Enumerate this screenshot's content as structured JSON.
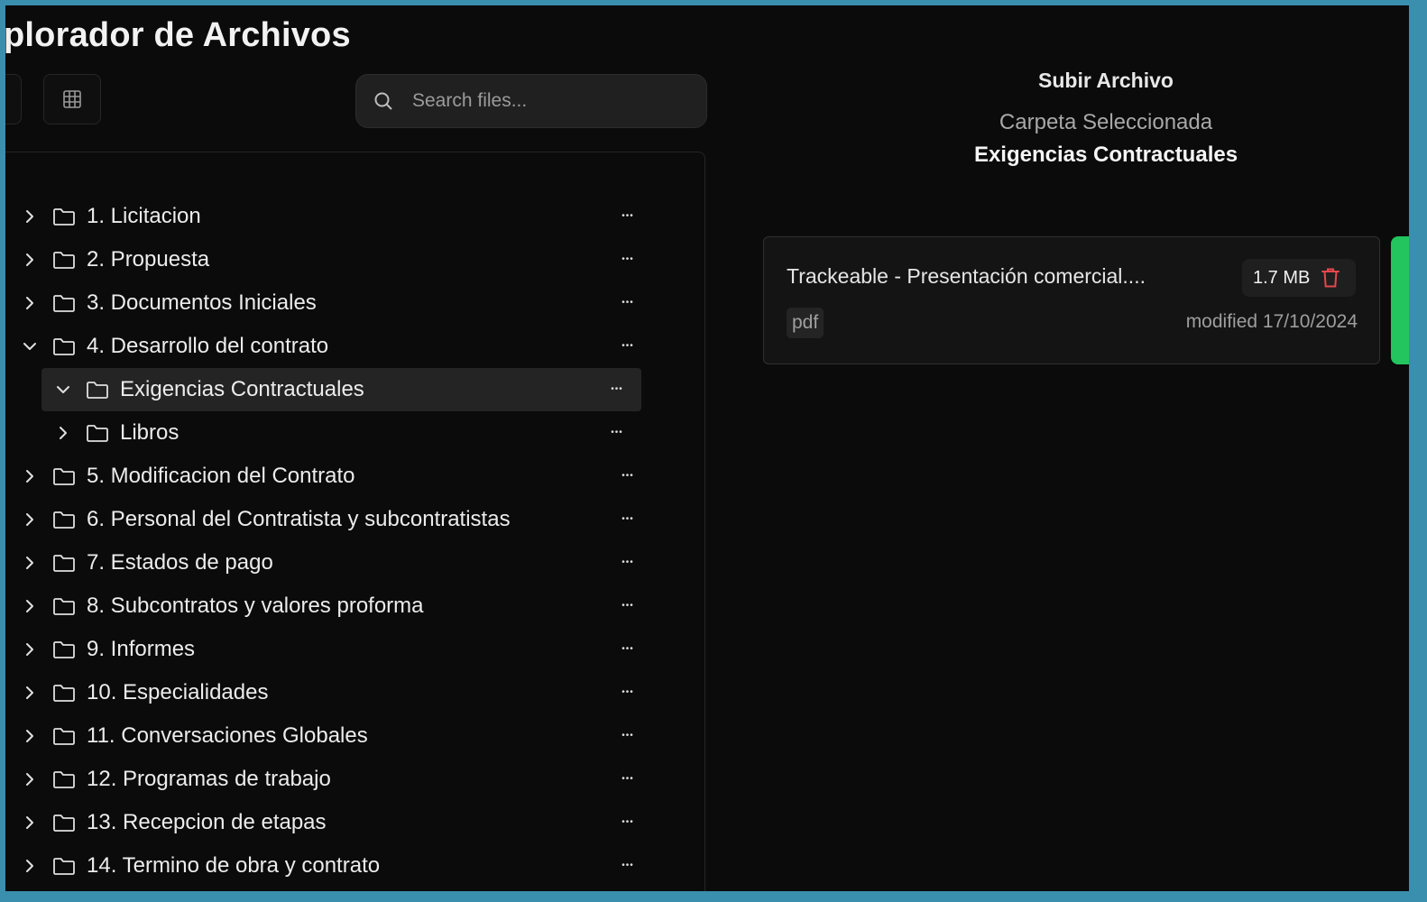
{
  "app": {
    "title": "plorador de Archivos"
  },
  "search": {
    "placeholder": "Search files..."
  },
  "tree": {
    "items": [
      {
        "label": "1. Licitacion",
        "level": 0,
        "expanded": false
      },
      {
        "label": "2. Propuesta",
        "level": 0,
        "expanded": false
      },
      {
        "label": "3. Documentos Iniciales",
        "level": 0,
        "expanded": false
      },
      {
        "label": "4. Desarrollo del contrato",
        "level": 0,
        "expanded": true
      },
      {
        "label": "Exigencias Contractuales",
        "level": 1,
        "expanded": true,
        "selected": true
      },
      {
        "label": "Libros",
        "level": 1,
        "expanded": false
      },
      {
        "label": "5. Modificacion del Contrato",
        "level": 0,
        "expanded": false
      },
      {
        "label": "6. Personal del Contratista y subcontratistas",
        "level": 0,
        "expanded": false
      },
      {
        "label": "7. Estados de pago",
        "level": 0,
        "expanded": false
      },
      {
        "label": "8. Subcontratos y valores proforma",
        "level": 0,
        "expanded": false
      },
      {
        "label": "9. Informes",
        "level": 0,
        "expanded": false
      },
      {
        "label": "10. Especialidades",
        "level": 0,
        "expanded": false
      },
      {
        "label": "11. Conversaciones Globales",
        "level": 0,
        "expanded": false
      },
      {
        "label": "12. Programas de trabajo",
        "level": 0,
        "expanded": false
      },
      {
        "label": "13. Recepcion de etapas",
        "level": 0,
        "expanded": false
      },
      {
        "label": "14. Termino de obra y contrato",
        "level": 0,
        "expanded": false
      }
    ]
  },
  "upload": {
    "title": "Subir Archivo",
    "folder_caption": "Carpeta Seleccionada",
    "folder_name": "Exigencias Contractuales"
  },
  "file": {
    "name": "Trackeable - Presentación comercial....",
    "size": "1.7 MB",
    "extension": "pdf",
    "modified": "modified 17/10/2024"
  },
  "colors": {
    "background": "#0b0b0b",
    "frame_border": "#3a8fae",
    "accent_green": "#22c55e",
    "danger": "#e5484d",
    "selected_row": "#242424"
  },
  "icons": {
    "search": "search-icon",
    "grid": "grid-icon",
    "folder": "folder-icon",
    "chevron_right": "chevron-right-icon",
    "chevron_down": "chevron-down-icon",
    "more": "more-horizontal-icon",
    "trash": "trash-icon"
  }
}
